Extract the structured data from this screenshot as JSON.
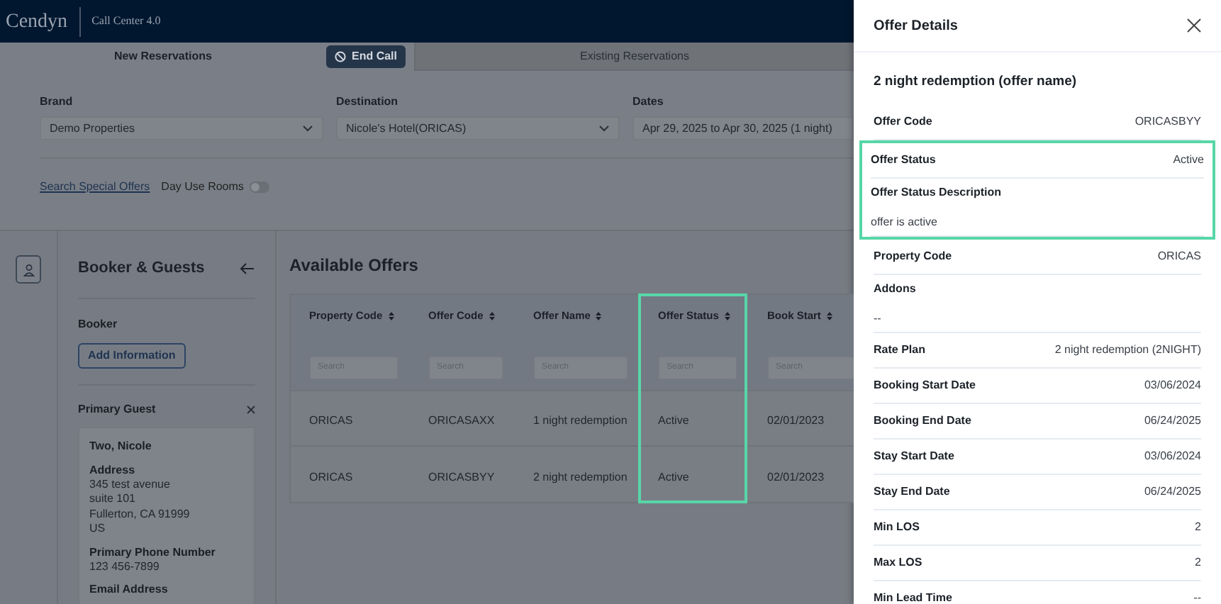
{
  "header": {
    "logo": "Cendyn",
    "app_name": "Call Center 4.0"
  },
  "tabs": [
    {
      "label": "New Reservations",
      "selected": true
    },
    {
      "label": "Existing Reservations",
      "selected": false
    }
  ],
  "end_call_button": "End Call",
  "search_form": {
    "fields": [
      {
        "label": "Brand",
        "value": "Demo Properties",
        "kind": "select"
      },
      {
        "label": "Destination",
        "value": "Nicole's Hotel(ORICAS)",
        "kind": "select"
      },
      {
        "label": "Dates",
        "value": "Apr 29, 2025 to Apr 30, 2025 (1 night)",
        "kind": "text"
      }
    ],
    "special_offers_link": "Search Special Offers",
    "day_use_rooms": {
      "label": "Day Use Rooms",
      "on": false
    }
  },
  "sidebar": {
    "title": "Booker & Guests",
    "booker": {
      "label": "Booker",
      "button": "Add Information"
    },
    "primary_guest": {
      "label": "Primary Guest",
      "name": "Two, Nicole",
      "sections": [
        {
          "label": "Address",
          "lines": [
            "345 test avenue",
            "suite 101",
            "Fullerton, CA 91999",
            "US"
          ]
        },
        {
          "label": "Primary Phone Number",
          "lines": [
            "123 456-7899"
          ]
        },
        {
          "label": "Email Address"
        }
      ]
    }
  },
  "offers": {
    "title": "Available Offers",
    "columns": [
      {
        "label": "Property Code",
        "placeholder": "Search",
        "highlighted": false
      },
      {
        "label": "Offer Code",
        "placeholder": "Search",
        "highlighted": false
      },
      {
        "label": "Offer Name",
        "placeholder": "Search",
        "highlighted": false
      },
      {
        "label": "Offer Status",
        "placeholder": "Search",
        "highlighted": true
      },
      {
        "label": "Book Start",
        "placeholder": "Search",
        "highlighted": false
      }
    ],
    "rows": [
      [
        "ORICAS",
        "ORICASAXX",
        "1 night redemption",
        "Active",
        "02/01/2023"
      ],
      [
        "ORICAS",
        "ORICASBYY",
        "2 night redemption",
        "Active",
        "02/01/2023"
      ]
    ]
  },
  "offer_details": {
    "title": "Offer Details",
    "offer_name": "2 night redemption (offer name)",
    "fields": [
      {
        "label": "Offer Code",
        "value": "ORICASBYY",
        "kind": "inline",
        "highlighted": false
      },
      {
        "label": "Offer Status",
        "value": "Active",
        "kind": "inline",
        "highlighted": true
      },
      {
        "label": "Offer Status Description",
        "value": "offer is active",
        "kind": "stacked",
        "highlighted": true
      },
      {
        "label": "Property Code",
        "value": "ORICAS",
        "kind": "inline",
        "highlighted": false
      },
      {
        "label": "Addons",
        "value": "--",
        "kind": "stacked",
        "highlighted": false
      },
      {
        "label": "Rate Plan",
        "value": "2 night redemption (2NIGHT)",
        "kind": "inline",
        "highlighted": false
      },
      {
        "label": "Booking Start Date",
        "value": "03/06/2024",
        "kind": "inline",
        "highlighted": false
      },
      {
        "label": "Booking End Date",
        "value": "06/24/2025",
        "kind": "inline",
        "highlighted": false
      },
      {
        "label": "Stay Start Date",
        "value": "03/06/2024",
        "kind": "inline",
        "highlighted": false
      },
      {
        "label": "Stay End Date",
        "value": "06/24/2025",
        "kind": "inline",
        "highlighted": false
      },
      {
        "label": "Min LOS",
        "value": "2",
        "kind": "inline",
        "highlighted": false
      },
      {
        "label": "Max LOS",
        "value": "2",
        "kind": "inline",
        "highlighted": false
      },
      {
        "label": "Min Lead Time",
        "value": "--",
        "kind": "inline",
        "highlighted": false
      }
    ]
  }
}
